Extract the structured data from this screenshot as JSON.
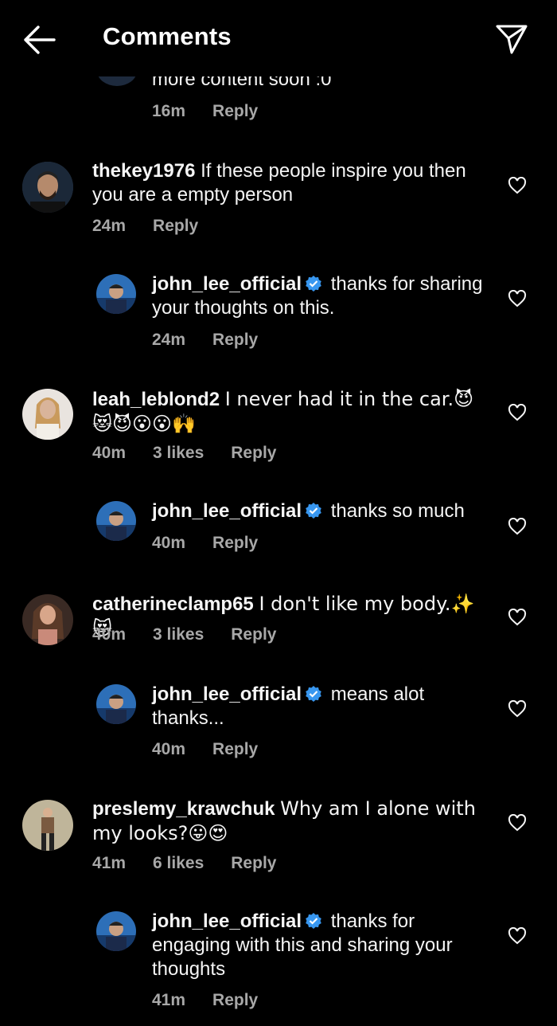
{
  "header": {
    "title": "Comments"
  },
  "cut_comment": {
    "text": "more content soon :0",
    "time": "16m",
    "reply_label": "Reply"
  },
  "comments": [
    {
      "username": "thekey1976",
      "text": "If these people inspire you then you are a empty person",
      "time": "24m",
      "likes": "",
      "reply_label": "Reply",
      "avatar_color": "#2b3a52"
    },
    {
      "username": "john_lee_official",
      "verified": true,
      "text": "thanks for sharing your thoughts on this.",
      "time": "24m",
      "likes": "",
      "reply_label": "Reply",
      "avatar_color": "#1e4f8e"
    },
    {
      "username": "leah_leblond2",
      "text": "I never had it in the car.😈😻😈😮😮🙌",
      "time": "40m",
      "likes": "3 likes",
      "reply_label": "Reply",
      "avatar_color": "#d8c4b2"
    },
    {
      "username": "john_lee_official",
      "verified": true,
      "text": "thanks so much",
      "time": "40m",
      "likes": "",
      "reply_label": "Reply",
      "avatar_color": "#1e4f8e"
    },
    {
      "username": "catherineclamp65",
      "text": "I don't like my body.✨😻",
      "time": "40m",
      "likes": "3 likes",
      "reply_label": "Reply",
      "avatar_color": "#6b4a3a"
    },
    {
      "username": "john_lee_official",
      "verified": true,
      "text": "means alot thanks...",
      "time": "40m",
      "likes": "",
      "reply_label": "Reply",
      "avatar_color": "#1e4f8e"
    },
    {
      "username": "preslemy_krawchuk",
      "text": "Why am I alone with my looks?😛😍",
      "time": "41m",
      "likes": "6 likes",
      "reply_label": "Reply",
      "avatar_color": "#8a7a5c"
    },
    {
      "username": "john_lee_official",
      "verified": true,
      "text": "thanks for engaging with this and sharing your thoughts",
      "time": "41m",
      "likes": "",
      "reply_label": "Reply",
      "avatar_color": "#1e4f8e"
    }
  ],
  "colors": {
    "background": "#000000",
    "text": "#f5f5f5",
    "meta": "#a8a8a8",
    "verified": "#3897f0"
  }
}
